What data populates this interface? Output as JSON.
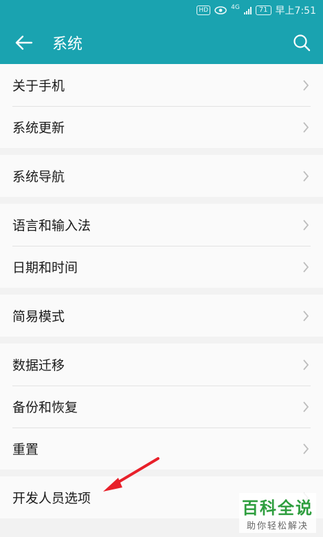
{
  "status_bar": {
    "hd_badge": "HD",
    "network_badge": "4G",
    "battery_level": "71",
    "time": "早上7:51"
  },
  "app_bar": {
    "title": "系统",
    "back_icon": "back-arrow-icon",
    "search_icon": "search-icon"
  },
  "groups": [
    {
      "items": [
        {
          "label": "关于手机"
        },
        {
          "label": "系统更新"
        }
      ]
    },
    {
      "items": [
        {
          "label": "系统导航"
        }
      ]
    },
    {
      "items": [
        {
          "label": "语言和输入法"
        },
        {
          "label": "日期和时间"
        }
      ]
    },
    {
      "items": [
        {
          "label": "简易模式"
        }
      ]
    },
    {
      "items": [
        {
          "label": "数据迁移"
        },
        {
          "label": "备份和恢复"
        },
        {
          "label": "重置"
        }
      ]
    },
    {
      "items": [
        {
          "label": "开发人员选项"
        }
      ]
    }
  ],
  "watermark": {
    "title": "百科全说",
    "subtitle": "助你轻松解决"
  },
  "colors": {
    "header": "#1aa3b0",
    "annotation_arrow": "#e8202a"
  }
}
